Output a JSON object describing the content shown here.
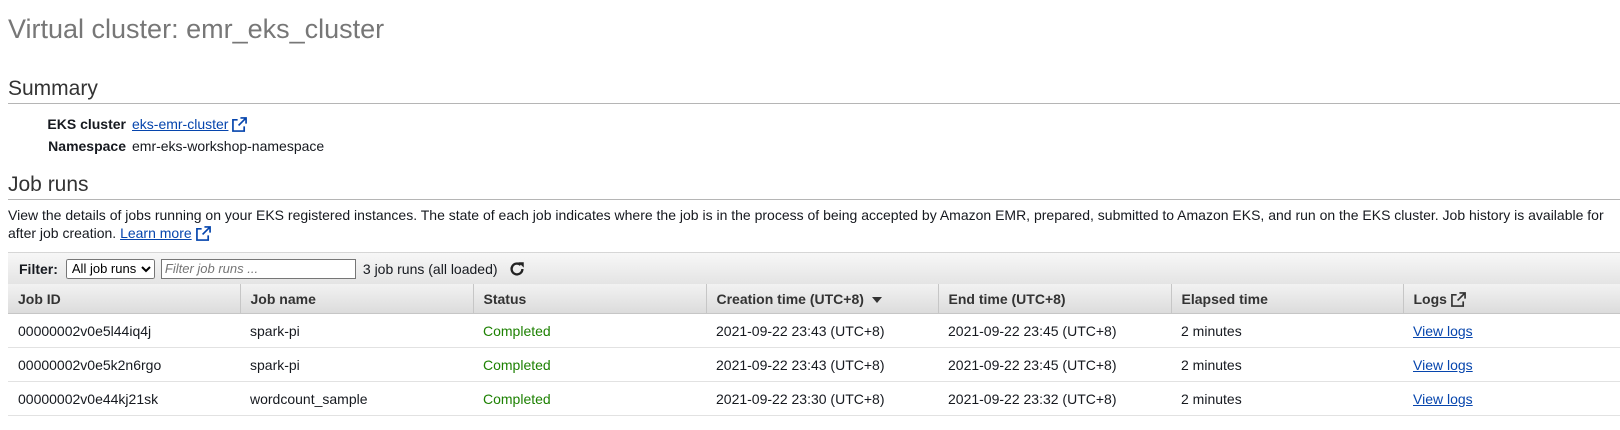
{
  "page": {
    "title": "Virtual cluster: emr_eks_cluster"
  },
  "summary": {
    "heading": "Summary",
    "eks_cluster_label": "EKS cluster",
    "eks_cluster_value": "eks-emr-cluster",
    "namespace_label": "Namespace",
    "namespace_value": "emr-eks-workshop-namespace"
  },
  "job_runs": {
    "heading": "Job runs",
    "description_line1": "View the details of jobs running on your EKS registered instances. The state of each job indicates where the job is in the process of being accepted by Amazon EMR, prepared, submitted to Amazon EKS, and run on the EKS cluster. Job history is available for",
    "description_line2": "after job creation.",
    "learn_more": "Learn more",
    "filter": {
      "label": "Filter:",
      "select_value": "All job runs",
      "placeholder": "Filter job runs ...",
      "count_text": "3 job runs (all loaded)"
    },
    "columns": [
      "Job ID",
      "Job name",
      "Status",
      "Creation time (UTC+8)",
      "End time (UTC+8)",
      "Elapsed time",
      "Logs"
    ],
    "rows": [
      {
        "job_id": "00000002v0e5l44iq4j",
        "job_name": "spark-pi",
        "status": "Completed",
        "creation": "2021-09-22 23:43 (UTC+8)",
        "end": "2021-09-22 23:45 (UTC+8)",
        "elapsed": "2 minutes",
        "logs": "View logs"
      },
      {
        "job_id": "00000002v0e5k2n6rgo",
        "job_name": "spark-pi",
        "status": "Completed",
        "creation": "2021-09-22 23:43 (UTC+8)",
        "end": "2021-09-22 23:45 (UTC+8)",
        "elapsed": "2 minutes",
        "logs": "View logs"
      },
      {
        "job_id": "00000002v0e44kj21sk",
        "job_name": "wordcount_sample",
        "status": "Completed",
        "creation": "2021-09-22 23:30 (UTC+8)",
        "end": "2021-09-22 23:32 (UTC+8)",
        "elapsed": "2 minutes",
        "logs": "View logs"
      }
    ]
  },
  "colors": {
    "link": "#0645ad",
    "status_completed": "#1d8102"
  }
}
